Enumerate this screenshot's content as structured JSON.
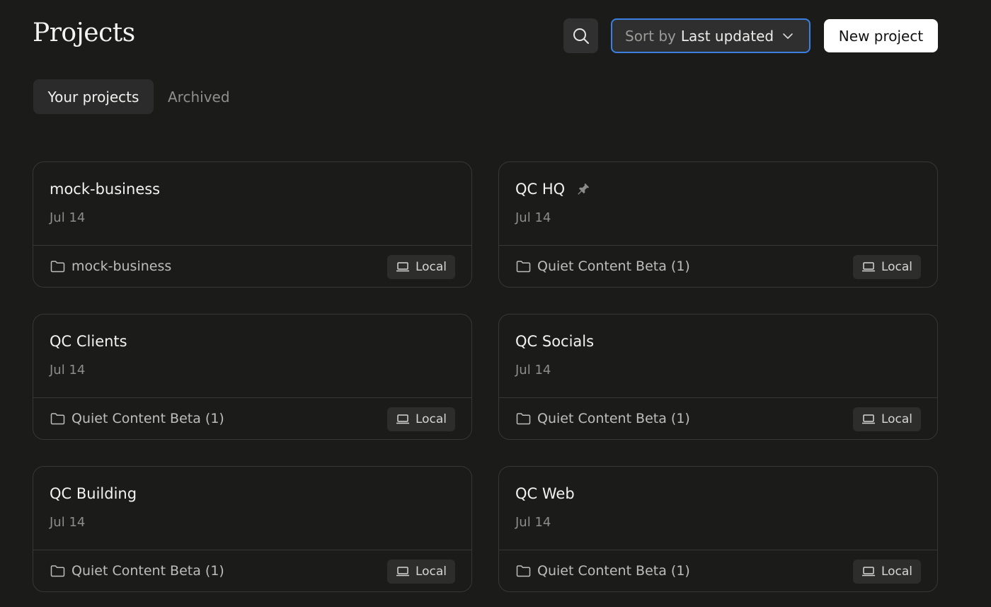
{
  "header": {
    "title": "Projects",
    "sort_prefix": "Sort by",
    "sort_value": "Last updated",
    "new_project_label": "New project"
  },
  "tabs": [
    {
      "label": "Your projects",
      "active": true
    },
    {
      "label": "Archived",
      "active": false
    }
  ],
  "projects": [
    {
      "name": "mock-business",
      "date": "Jul 14",
      "folder": "mock-business",
      "location": "Local",
      "pinned": false
    },
    {
      "name": "QC HQ",
      "date": "Jul 14",
      "folder": "Quiet Content Beta (1)",
      "location": "Local",
      "pinned": true
    },
    {
      "name": "QC Clients",
      "date": "Jul 14",
      "folder": "Quiet Content Beta (1)",
      "location": "Local",
      "pinned": false
    },
    {
      "name": "QC Socials",
      "date": "Jul 14",
      "folder": "Quiet Content Beta (1)",
      "location": "Local",
      "pinned": false
    },
    {
      "name": "QC Building",
      "date": "Jul 14",
      "folder": "Quiet Content Beta (1)",
      "location": "Local",
      "pinned": false
    },
    {
      "name": "QC Web",
      "date": "Jul 14",
      "folder": "Quiet Content Beta (1)",
      "location": "Local",
      "pinned": false
    }
  ],
  "colors": {
    "background": "#1b1b1a",
    "accent_focus": "#3b7fe0",
    "card_border": "#373735",
    "primary_button": "#ffffff"
  },
  "icons": {
    "search": "search-icon",
    "sort": "chevron-down-icon",
    "pin": "pin-icon",
    "folder": "folder-icon",
    "local": "laptop-icon"
  }
}
